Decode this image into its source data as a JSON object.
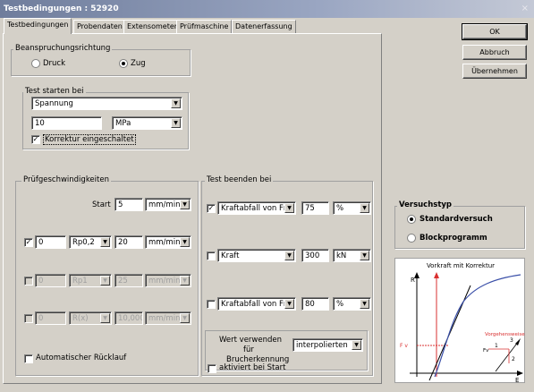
{
  "window": {
    "title": "Testbedingungen : 52920",
    "close_glyph": "×"
  },
  "tabs": [
    {
      "label": "Testbedingungen",
      "active": true
    },
    {
      "label": "Probendaten"
    },
    {
      "label": "Extensometer"
    },
    {
      "label": "Prüfmaschine"
    },
    {
      "label": "Datenerfassung"
    }
  ],
  "beanspruchung": {
    "title": "Beanspruchungsrichtung",
    "option_druck": "Druck",
    "option_zug": "Zug",
    "selected": "Zug"
  },
  "test_starten": {
    "title": "Test starten bei",
    "mode_value": "Spannung",
    "threshold_value": "10",
    "unit_value": "MPa",
    "korrektur_label": "Korrektur eingeschaltet",
    "korrektur_checked": true
  },
  "pruefgeschwindigkeiten": {
    "title": "Prüfgeschwindigkeiten",
    "start_label": "Start",
    "start_value": "5",
    "start_unit": "mm/min",
    "rows": [
      {
        "checked": true,
        "enabled": true,
        "from": "0",
        "point": "Rp0,2",
        "speed": "20",
        "unit": "mm/min"
      },
      {
        "checked": false,
        "enabled": false,
        "from": "0",
        "point": "Rp1",
        "speed": "25",
        "unit": "mm/min"
      },
      {
        "checked": false,
        "enabled": false,
        "from": "0",
        "point": "R(x)",
        "speed": "10,000",
        "unit": "mm/min"
      }
    ],
    "auto_ruecklauf_label": "Automatischer Rücklauf",
    "auto_ruecklauf_checked": false
  },
  "test_beenden": {
    "title": "Test beenden bei",
    "rows": [
      {
        "checked": true,
        "criterion": "Kraftabfall von Fm",
        "value": "75",
        "unit": "%"
      },
      {
        "checked": false,
        "criterion": "Kraft",
        "value": "300",
        "unit": "kN"
      },
      {
        "checked": false,
        "criterion": "Kraftabfall von Fm",
        "value": "80",
        "unit": "%"
      }
    ],
    "wert_verwenden_label_1": "Wert verwenden",
    "wert_verwenden_label_2": "für",
    "wert_verwenden_label_3": "Brucherkennung",
    "wert_verwenden_value": "interpolierten",
    "aktiviert_label": "aktiviert bei Start",
    "aktiviert_checked": false
  },
  "buttons": {
    "ok": "OK",
    "abbruch": "Abbruch",
    "uebernehmen": "Übernehmen"
  },
  "versuchstyp": {
    "title": "Versuchstyp",
    "option_standard": "Standardversuch",
    "option_block": "Blockprogramm",
    "selected": "Standardversuch"
  },
  "diagram": {
    "title": "Vorkraft mit Korrektur",
    "y_label": "R",
    "x_label": "E",
    "fv_label": "F v",
    "inset_title": "Vorgehensweise",
    "inset_fv": "Fv",
    "inset_n1": "1",
    "inset_n2": "2",
    "inset_n3": "3",
    "colors": {
      "curve": "#3a4fa8",
      "red": "#d93030",
      "black": "#000000"
    }
  },
  "colors": {
    "dialog_bg": "#d4d0c8",
    "title_bar": "#7f8cab"
  }
}
